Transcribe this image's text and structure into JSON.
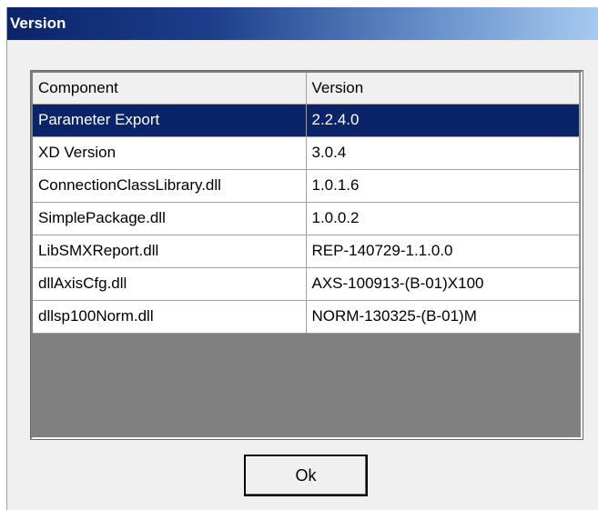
{
  "window": {
    "title": "Version"
  },
  "grid": {
    "columns": [
      "Component",
      "Version"
    ],
    "rows": [
      {
        "component": "Parameter Export",
        "version": "2.2.4.0",
        "selected": true
      },
      {
        "component": "XD Version",
        "version": "3.0.4",
        "selected": false
      },
      {
        "component": "ConnectionClassLibrary.dll",
        "version": "1.0.1.6",
        "selected": false
      },
      {
        "component": "SimplePackage.dll",
        "version": "1.0.0.2",
        "selected": false
      },
      {
        "component": "LibSMXReport.dll",
        "version": "REP-140729-1.1.0.0",
        "selected": false
      },
      {
        "component": "dllAxisCfg.dll",
        "version": "AXS-100913-(B-01)X100",
        "selected": false
      },
      {
        "component": "dllsp100Norm.dll",
        "version": "NORM-130325-(B-01)M",
        "selected": false
      }
    ]
  },
  "buttons": {
    "ok_label": "Ok"
  },
  "colors": {
    "selection": "#0a246a",
    "grid_empty": "#808080",
    "dialog_bg": "#f0f0f0"
  }
}
